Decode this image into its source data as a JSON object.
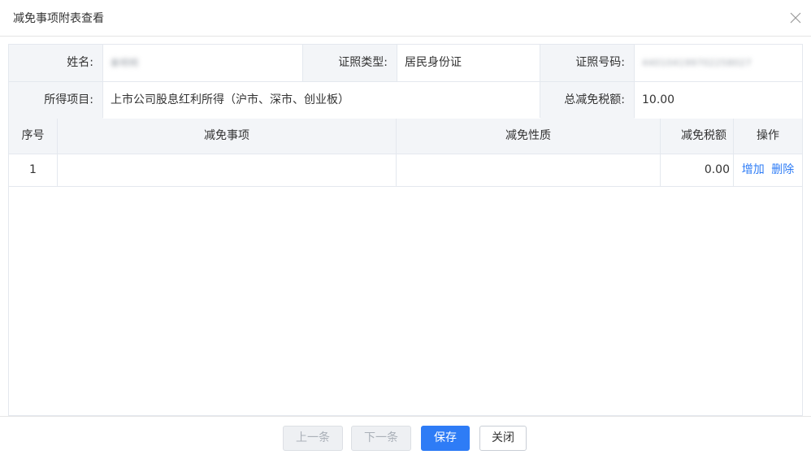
{
  "dialog": {
    "title": "减免事项附表查看",
    "close_icon": "close-icon"
  },
  "info": {
    "name_label": "姓名:",
    "name_value": "秦明明",
    "id_type_label": "证照类型:",
    "id_type_value": "居民身份证",
    "id_number_label": "证照号码:",
    "id_number_value": "440104199702258027",
    "income_item_label": "所得项目:",
    "income_item_value": "上市公司股息红利所得（沪市、深市、创业板）",
    "total_relief_label": "总减免税额:",
    "total_relief_value": "10.00"
  },
  "table": {
    "columns": [
      "序号",
      "减免事项",
      "减免性质",
      "减免税额",
      "操作"
    ],
    "rows": [
      {
        "index": "1",
        "item": "",
        "nature": "",
        "amount": "0.00",
        "add_label": "增加",
        "delete_label": "删除"
      }
    ]
  },
  "footer": {
    "prev_label": "上一条",
    "next_label": "下一条",
    "save_label": "保存",
    "close_label": "关闭"
  },
  "colors": {
    "primary": "#2e7cf6",
    "header_bg": "#f3f5f8",
    "border": "#e4e8ee"
  }
}
